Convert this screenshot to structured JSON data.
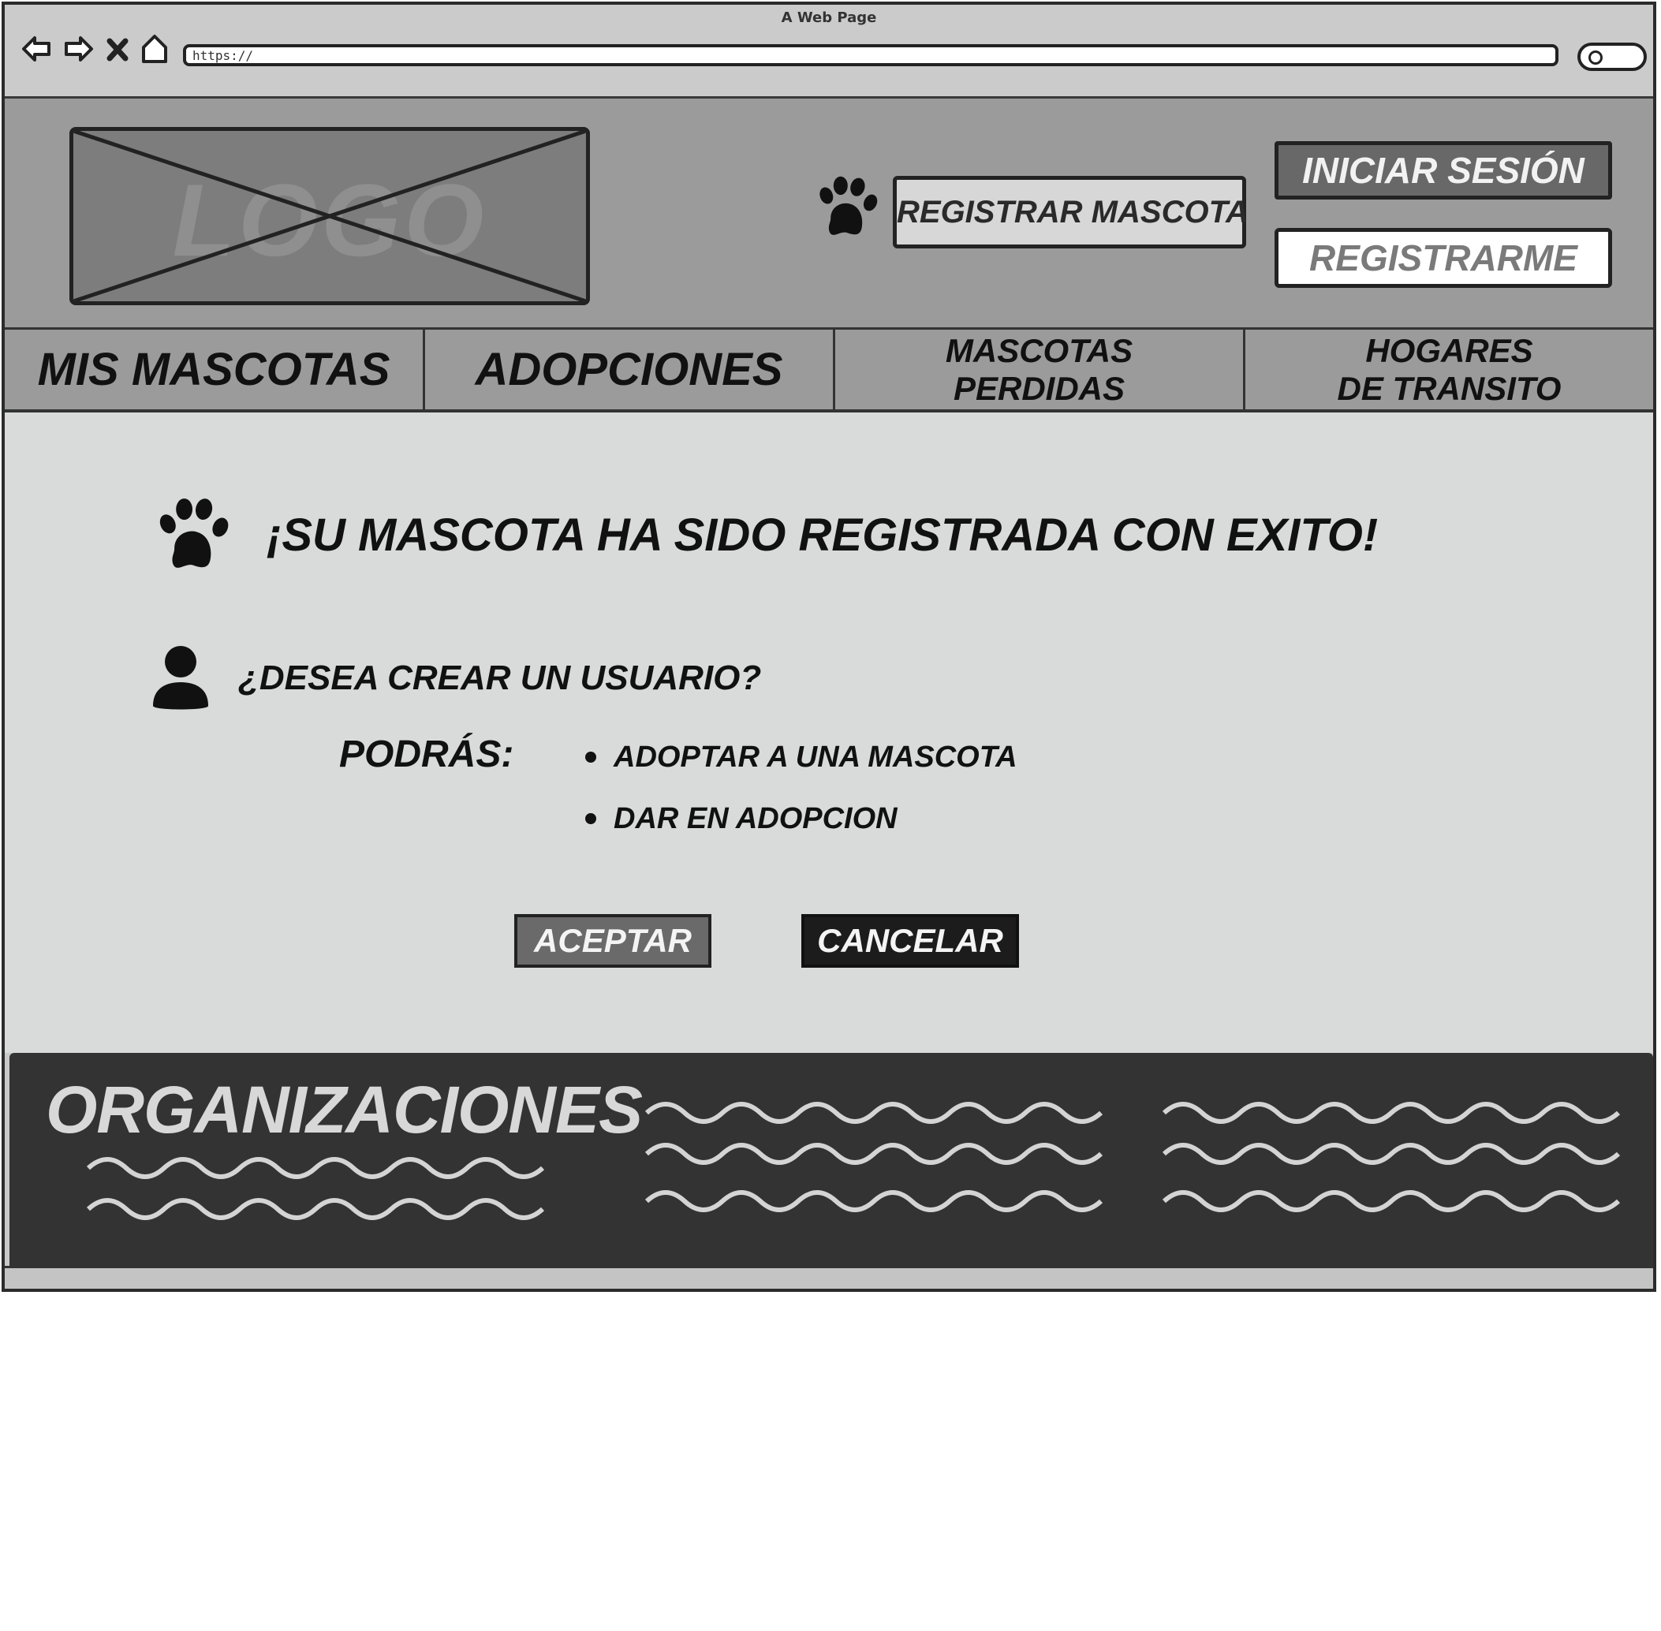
{
  "window": {
    "title": "A Web Page",
    "url": "https://"
  },
  "header": {
    "logo_text": "LOGO",
    "register_pet_button": "REGISTRAR MASCOTA",
    "login_button": "INICIAR SESIÓN",
    "signup_button": "REGISTRARME"
  },
  "nav": {
    "tabs": [
      {
        "label": "MIS MASCOTAS"
      },
      {
        "label": "ADOPCIONES"
      },
      {
        "label_line1": "MASCOTAS",
        "label_line2": "PERDIDAS"
      },
      {
        "label_line1": "HOGARES",
        "label_line2": "DE TRANSITO"
      }
    ]
  },
  "main": {
    "success_message": "¡SU MASCOTA HA SIDO REGISTRADA CON EXITO!",
    "question": "¿DESEA CREAR UN USUARIO?",
    "benefits_label": "PODRÁS:",
    "benefits": [
      "ADOPTAR A UNA MASCOTA",
      "DAR EN ADOPCION"
    ],
    "accept_button": "ACEPTAR",
    "cancel_button": "CANCELAR"
  },
  "footer": {
    "title": "ORGANIZACIONES"
  },
  "icons": {
    "paw": "paw-icon",
    "user": "user-icon"
  },
  "colors": {
    "header_bg": "#9b9b9b",
    "content_bg": "#d9dada",
    "footer_bg": "#333333",
    "accept_bg": "#6a6a6a",
    "cancel_bg": "#1c1c1c"
  }
}
